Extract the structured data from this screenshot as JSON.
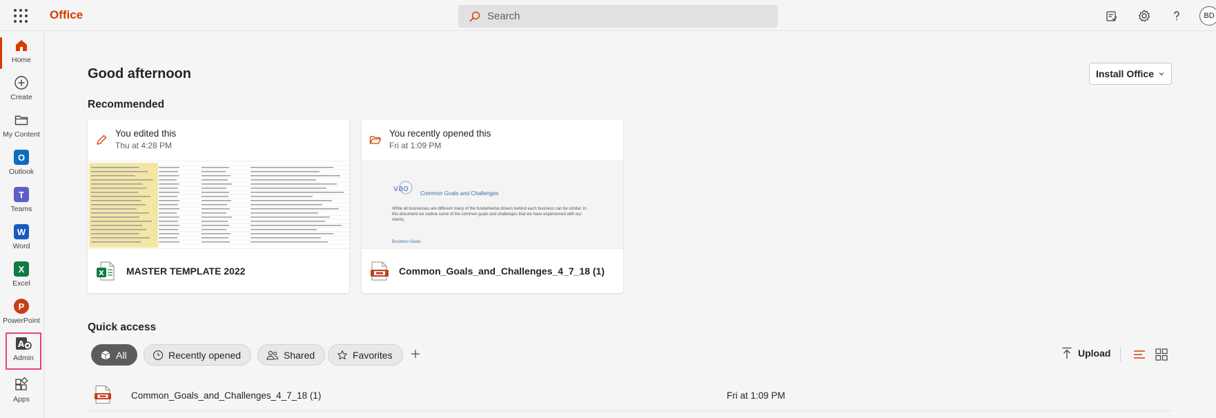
{
  "header": {
    "brand": "Office",
    "search_placeholder": "Search",
    "avatar_initials": "BD",
    "icons": [
      "waffle-icon",
      "task-icon",
      "settings-icon",
      "help-icon"
    ]
  },
  "rail": {
    "items": [
      {
        "label": "Home",
        "icon": "home-icon"
      },
      {
        "label": "Create",
        "icon": "plus-circle-icon"
      },
      {
        "label": "My Content",
        "icon": "folder-icon"
      },
      {
        "label": "Outlook",
        "icon": "outlook-icon"
      },
      {
        "label": "Teams",
        "icon": "teams-icon"
      },
      {
        "label": "Word",
        "icon": "word-icon"
      },
      {
        "label": "Excel",
        "icon": "excel-icon"
      },
      {
        "label": "PowerPoint",
        "icon": "powerpoint-icon"
      },
      {
        "label": "Admin",
        "icon": "admin-icon"
      },
      {
        "label": "Apps",
        "icon": "apps-icon"
      }
    ]
  },
  "main": {
    "greeting": "Good afternoon",
    "install_label": "Install Office",
    "recommended_title": "Recommended",
    "cards": [
      {
        "activity": "You edited this",
        "time": "Thu at 4:28 PM",
        "file": "MASTER TEMPLATE 2022",
        "icon": "excel-file-icon"
      },
      {
        "activity": "You recently opened this",
        "time": "Fri at 1:09 PM",
        "file": "Common_Goals_and_Challenges_4_7_18 (1)",
        "icon": "pdf-file-icon",
        "thumb": {
          "heading": "Common Goals and Challenges",
          "body": "While all businesses are different many of the fundamental drivers behind each business can be similar. In this document we outline some of the common goals and challenges that we have experienced with our clients.",
          "subheading": "Business Goals"
        }
      }
    ],
    "quick_access_title": "Quick access",
    "filters": [
      "All",
      "Recently opened",
      "Shared",
      "Favorites"
    ],
    "upload_label": "Upload",
    "files": [
      {
        "name": "Common_Goals_and_Challenges_4_7_18 (1)",
        "date": "Fri at 1:09 PM"
      }
    ]
  },
  "colors": {
    "brand": "#d83b01",
    "highlight": "#e83e8c",
    "excel": "#107c41",
    "word": "#185abd",
    "outlook": "#0f6cbd",
    "teams": "#5b5fc7",
    "powerpoint": "#c43e1c"
  }
}
